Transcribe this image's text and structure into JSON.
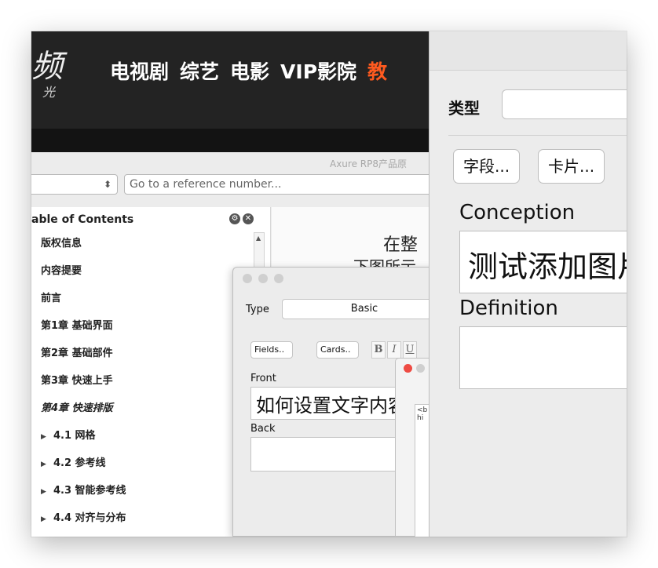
{
  "video_site": {
    "logo_char": "频",
    "logo_sub": "光",
    "nav": [
      "电视剧",
      "综艺",
      "电影",
      "VIP影院",
      "教"
    ]
  },
  "reader": {
    "title": "Axure RP8产品原",
    "stepper": "⬍",
    "goto_placeholder": "Go to a reference number...",
    "toc_title": "able of Contents",
    "toc_items": [
      {
        "label": "版权信息"
      },
      {
        "label": "内容提要"
      },
      {
        "label": "前言"
      },
      {
        "label": "第1章 基础界面"
      },
      {
        "label": "第2章 基础部件"
      },
      {
        "label": "第3章 快速上手"
      },
      {
        "label": "第4章 快速排版"
      },
      {
        "label": "4.1 网格"
      },
      {
        "label": "4.2 参考线"
      },
      {
        "label": "4.3 智能参考线"
      },
      {
        "label": "4.4 对齐与分布"
      }
    ],
    "content_line1": "在整",
    "content_line2": "下图所示"
  },
  "small_add": {
    "type_label": "Type",
    "type_value": "Basic",
    "fields_btn": "Fields..",
    "cards_btn": "Cards..",
    "fmt": [
      "B",
      "I",
      "U"
    ],
    "front_label": "Front",
    "front_value": "如何设置文字内容",
    "back_label": "Back"
  },
  "tiny_window": {
    "text": "<b\nhi"
  },
  "main_add": {
    "type_label": "类型",
    "type_value": "",
    "fields_btn": "字段...",
    "cards_btn": "卡片...",
    "concept_label": "Conception",
    "concept_value": "测试添加图片",
    "definition_label": "Definition",
    "definition_value": ""
  }
}
